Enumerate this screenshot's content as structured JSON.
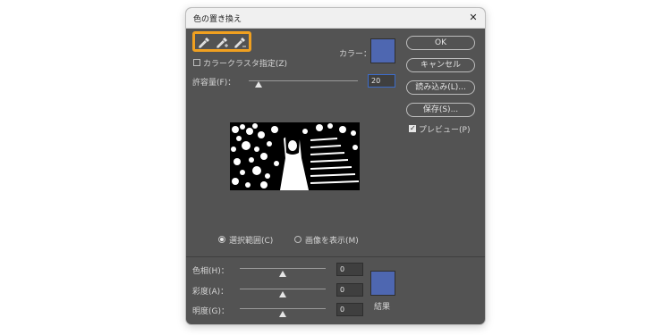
{
  "dialog": {
    "title": "色の置き換え",
    "close_glyph": "✕",
    "tools": [
      "eyedropper-icon",
      "eyedropper-plus-icon",
      "eyedropper-minus-icon"
    ],
    "tools_highlight_color": "#f0a020"
  },
  "selection": {
    "color_label": "カラー：",
    "color_swatch": "#4e67b1",
    "cluster_checkbox_label": "カラークラスタ指定(Z)",
    "cluster_checked": false,
    "fuzziness_label": "許容量(F)：",
    "fuzziness_value": "20",
    "radio_selection_label": "選択範囲(C)",
    "radio_image_label": "画像を表示(M)",
    "radio_selected": "selection"
  },
  "buttons": {
    "ok": "OK",
    "cancel": "キャンセル",
    "load": "読み込み(L)...",
    "save": "保存(S)...",
    "preview_label": "プレビュー(P)",
    "preview_checked": true
  },
  "replacement": {
    "hue_label": "色相(H)：",
    "hue_value": "0",
    "saturation_label": "彩度(A)：",
    "saturation_value": "0",
    "lightness_label": "明度(G)：",
    "lightness_value": "0",
    "result_label": "結果",
    "result_swatch": "#4e67b1"
  }
}
